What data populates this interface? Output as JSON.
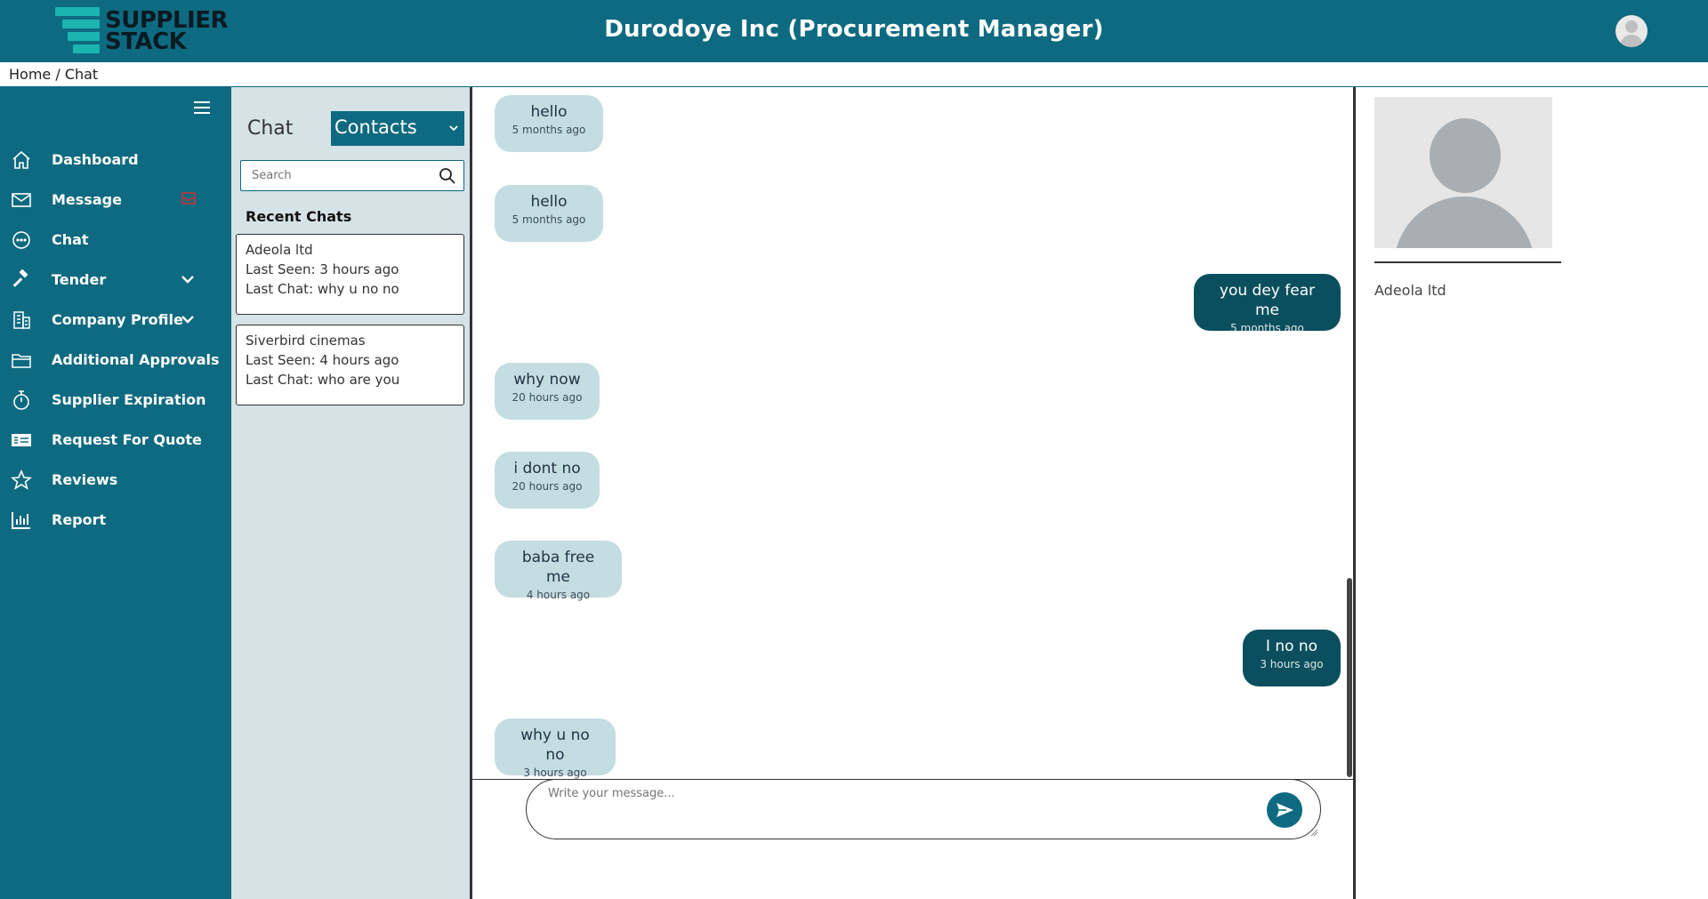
{
  "app": {
    "brand_line1": "SUPPLIER",
    "brand_line2": "STACK",
    "title": "Durodoye Inc (Procurement Manager)"
  },
  "breadcrumb": "Home / Chat",
  "sidebar": {
    "items": [
      {
        "label": "Dashboard",
        "icon": "home-icon"
      },
      {
        "label": "Message",
        "icon": "mail-icon"
      },
      {
        "label": "Chat",
        "icon": "chat-bubble-icon"
      },
      {
        "label": "Tender",
        "icon": "gavel-icon"
      },
      {
        "label": "Company Profile",
        "icon": "building-icon"
      },
      {
        "label": "Additional Approvals",
        "icon": "folder-icon"
      },
      {
        "label": "Supplier Expiration",
        "icon": "stopwatch-icon"
      },
      {
        "label": "Request For Quote",
        "icon": "quote-card-icon"
      },
      {
        "label": "Reviews",
        "icon": "star-icon"
      },
      {
        "label": "Report",
        "icon": "bar-chart-icon"
      }
    ]
  },
  "chatlist": {
    "title": "Chat",
    "filter_selected": "Contacts",
    "search_placeholder": "Search",
    "recent_label": "Recent Chats",
    "chats": [
      {
        "name": "Adeola ltd",
        "last_seen": "Last Seen: 3 hours ago",
        "last_chat": "Last Chat: why u no no"
      },
      {
        "name": "Siverbird cinemas",
        "last_seen": "Last Seen: 4 hours ago",
        "last_chat": "Last Chat: who are you"
      }
    ]
  },
  "conversation": {
    "messages": [
      {
        "text": "hello",
        "time": "5 months ago",
        "direction": "in"
      },
      {
        "text": "hello",
        "time": "5 months ago",
        "direction": "in"
      },
      {
        "text": "you dey fear me",
        "time": "5 months ago",
        "direction": "out"
      },
      {
        "text": "why now",
        "time": "20 hours ago",
        "direction": "in"
      },
      {
        "text": "i dont no",
        "time": "20 hours ago",
        "direction": "in"
      },
      {
        "text": "baba free me",
        "time": "4 hours ago",
        "direction": "in"
      },
      {
        "text": "I no no",
        "time": "3 hours ago",
        "direction": "out"
      },
      {
        "text": "why u no no",
        "time": "3 hours ago",
        "direction": "in"
      }
    ],
    "composer_placeholder": "Write your message..."
  },
  "profile": {
    "name": "Adeola ltd"
  },
  "colors": {
    "primary": "#0e6a80",
    "panel": "#d5e3e6",
    "incoming_bubble": "#c4dde0",
    "outgoing_bubble": "#0b4f5e",
    "logo_accent": "#1ab5b0"
  }
}
